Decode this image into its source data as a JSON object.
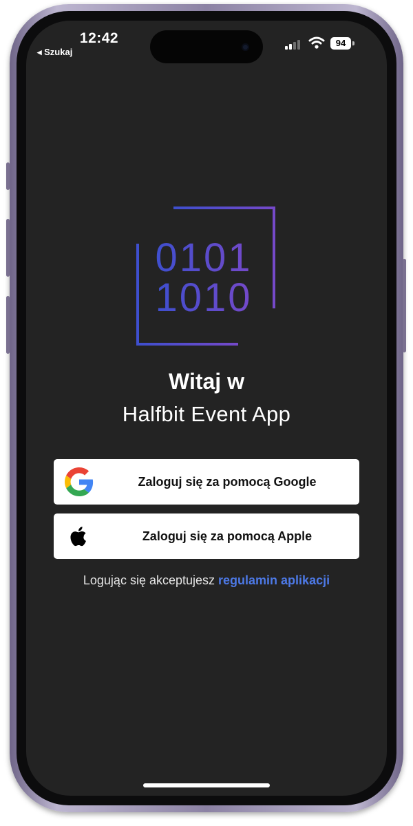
{
  "status_bar": {
    "time": "12:42",
    "back_label": "◂ Szukaj",
    "battery": "94",
    "signal_bars": 2,
    "signal_icon": "cellular-signal-icon",
    "wifi_icon": "wifi-icon"
  },
  "logo": {
    "lines": [
      "0101",
      "1010"
    ],
    "gradient_start": "#3e4fce",
    "gradient_end": "#7549c9"
  },
  "welcome": {
    "line1": "Witaj w",
    "line2": "Halfbit Event App"
  },
  "login": {
    "google": {
      "label": "Zaloguj się za pomocą Google",
      "icon": "google-icon"
    },
    "apple": {
      "label": "Zaloguj się za pomocą Apple",
      "icon": "apple-icon"
    }
  },
  "terms": {
    "prefix": "Logując się akceptujesz",
    "link": "regulamin aplikacji",
    "link_color": "#4d79e6"
  },
  "colors": {
    "screen_background": "#232323",
    "button_background": "#ffffff",
    "frame": "#8c82a4"
  }
}
